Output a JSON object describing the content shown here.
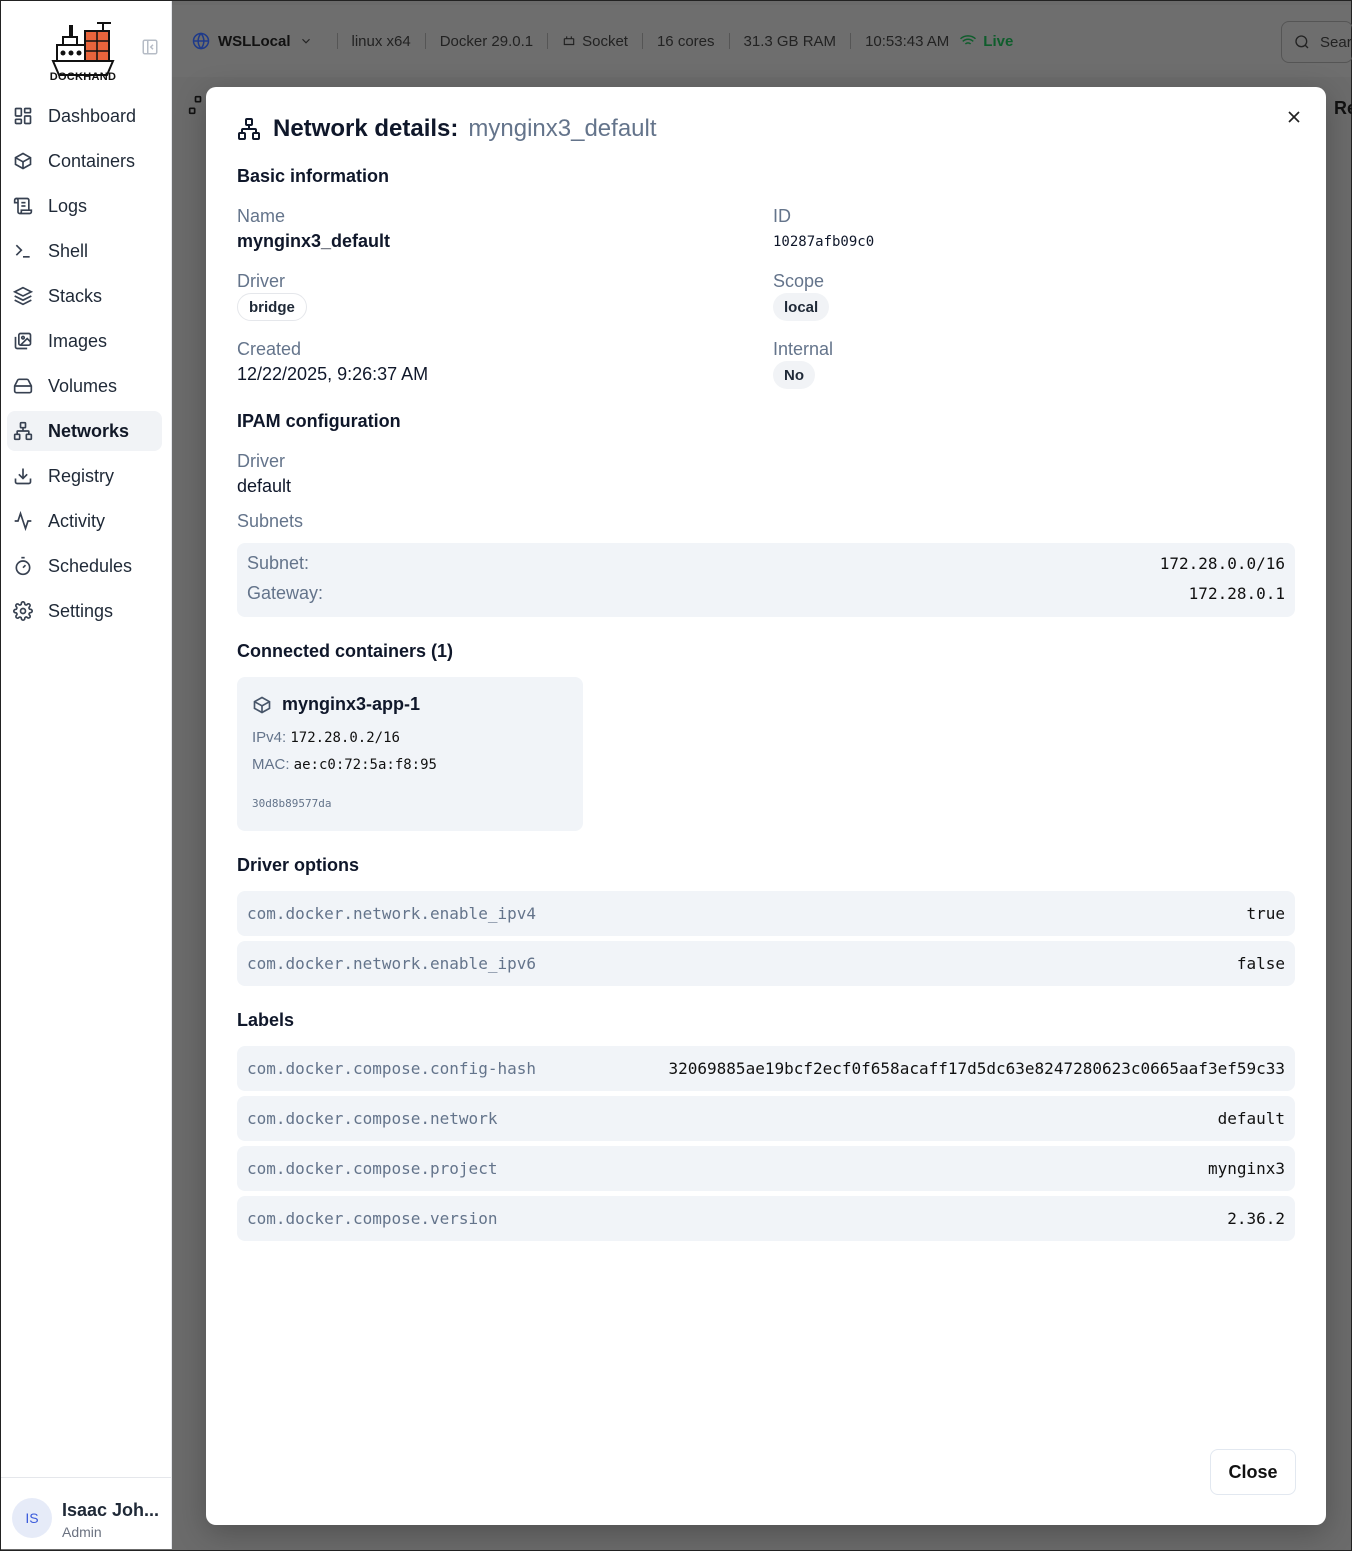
{
  "app": {
    "name": "DOCKHAND"
  },
  "sidebar": {
    "items": [
      {
        "label": "Dashboard",
        "icon": "dashboard-icon",
        "active": false
      },
      {
        "label": "Containers",
        "icon": "box-icon",
        "active": false
      },
      {
        "label": "Logs",
        "icon": "scroll-icon",
        "active": false
      },
      {
        "label": "Shell",
        "icon": "terminal-icon",
        "active": false
      },
      {
        "label": "Stacks",
        "icon": "layers-icon",
        "active": false
      },
      {
        "label": "Images",
        "icon": "images-icon",
        "active": false
      },
      {
        "label": "Volumes",
        "icon": "hard-drive-icon",
        "active": false
      },
      {
        "label": "Networks",
        "icon": "network-icon",
        "active": true
      },
      {
        "label": "Registry",
        "icon": "download-icon",
        "active": false
      },
      {
        "label": "Activity",
        "icon": "activity-icon",
        "active": false
      },
      {
        "label": "Schedules",
        "icon": "timer-icon",
        "active": false
      },
      {
        "label": "Settings",
        "icon": "gear-icon",
        "active": false
      }
    ],
    "user": {
      "initials": "IS",
      "name": "Isaac Joh...",
      "role": "Admin"
    }
  },
  "topbar": {
    "environment": "WSLLocal",
    "platform": "linux x64",
    "docker": "Docker 29.0.1",
    "connection": "Socket",
    "cores": "16 cores",
    "ram": "31.3 GB RAM",
    "time": "10:53:43 AM",
    "status": "Live",
    "search_placeholder": "Sear",
    "fragment_text": "Re"
  },
  "modal": {
    "title": "Network details:",
    "network_name": "mynginx3_default",
    "basic": {
      "heading": "Basic information",
      "name_label": "Name",
      "name_value": "mynginx3_default",
      "id_label": "ID",
      "id_value": "10287afb09c0",
      "driver_label": "Driver",
      "driver_value": "bridge",
      "scope_label": "Scope",
      "scope_value": "local",
      "created_label": "Created",
      "created_value": "12/22/2025, 9:26:37 AM",
      "internal_label": "Internal",
      "internal_value": "No"
    },
    "ipam": {
      "heading": "IPAM configuration",
      "driver_label": "Driver",
      "driver_value": "default",
      "subnets_label": "Subnets",
      "subnet_key": "Subnet:",
      "subnet_value": "172.28.0.0/16",
      "gateway_key": "Gateway:",
      "gateway_value": "172.28.0.1"
    },
    "containers": {
      "heading": "Connected containers (1)",
      "items": [
        {
          "name": "mynginx3-app-1",
          "ipv4_label": "IPv4:",
          "ipv4": "172.28.0.2/16",
          "mac_label": "MAC:",
          "mac": "ae:c0:72:5a:f8:95",
          "id": "30d8b89577da"
        }
      ]
    },
    "driver_options": {
      "heading": "Driver options",
      "rows": [
        {
          "key": "com.docker.network.enable_ipv4",
          "value": "true"
        },
        {
          "key": "com.docker.network.enable_ipv6",
          "value": "false"
        }
      ]
    },
    "labels": {
      "heading": "Labels",
      "rows": [
        {
          "key": "com.docker.compose.config-hash",
          "value": "32069885ae19bcf2ecf0f658acaff17d5dc63e8247280623c0665aaf3ef59c33"
        },
        {
          "key": "com.docker.compose.network",
          "value": "default"
        },
        {
          "key": "com.docker.compose.project",
          "value": "mynginx3"
        },
        {
          "key": "com.docker.compose.version",
          "value": "2.36.2"
        }
      ]
    },
    "close_label": "Close"
  },
  "colors": {
    "accent_live": "#16a34a",
    "muted": "#64748b",
    "panel": "#f1f4f8"
  }
}
